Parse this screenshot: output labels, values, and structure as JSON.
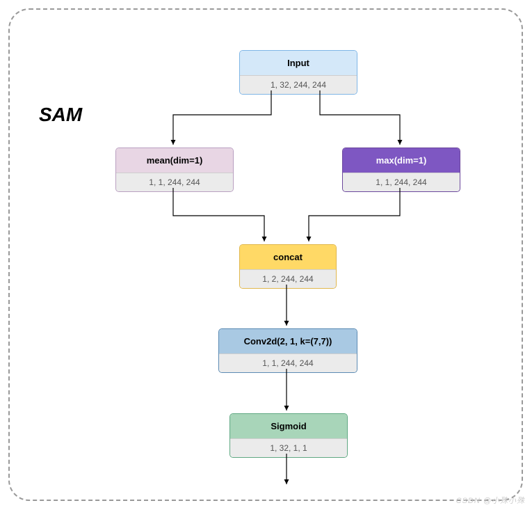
{
  "title": "SAM",
  "nodes": {
    "input": {
      "label": "Input",
      "shape": "1, 32, 244, 244"
    },
    "mean": {
      "label": "mean(dim=1)",
      "shape": "1, 1, 244, 244"
    },
    "max": {
      "label": "max(dim=1)",
      "shape": "1, 1, 244, 244"
    },
    "concat": {
      "label": "concat",
      "shape": "1, 2, 244, 244"
    },
    "conv": {
      "label": "Conv2d(2, 1, k=(7,7))",
      "shape": "1, 1, 244, 244"
    },
    "sigmoid": {
      "label": "Sigmoid",
      "shape": "1, 32, 1, 1"
    }
  },
  "edges": [
    [
      "input",
      "mean"
    ],
    [
      "input",
      "max"
    ],
    [
      "mean",
      "concat"
    ],
    [
      "max",
      "concat"
    ],
    [
      "concat",
      "conv"
    ],
    [
      "conv",
      "sigmoid"
    ],
    [
      "sigmoid",
      "out"
    ]
  ],
  "watermark": "CSDN @小殊小殊"
}
